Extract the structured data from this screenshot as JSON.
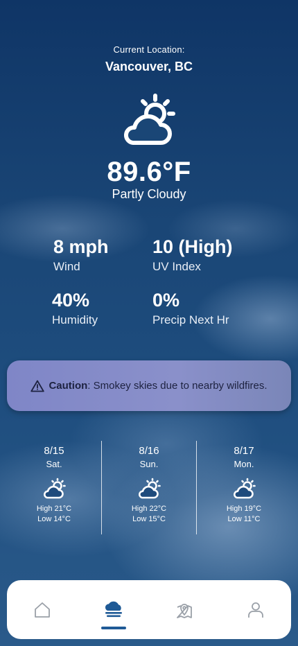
{
  "location": {
    "label": "Current Location:",
    "city": "Vancouver, BC"
  },
  "current": {
    "icon": "partly-cloudy-icon",
    "temperature": "89.6°F",
    "condition": "Partly Cloudy"
  },
  "stats": [
    {
      "value": "8 mph",
      "label": "Wind"
    },
    {
      "value": "10 (High)",
      "label": "UV Index"
    },
    {
      "value": "40%",
      "label": "Humidity"
    },
    {
      "value": "0%",
      "label": "Precip Next Hr"
    }
  ],
  "alert": {
    "icon": "warning-triangle-icon",
    "title": "Caution",
    "message": ": Smokey skies due to nearby wildfires."
  },
  "forecast": [
    {
      "date": "8/15",
      "weekday": "Sat.",
      "icon": "partly-cloudy-icon",
      "high": "High 21°C",
      "low": "Low 14°C"
    },
    {
      "date": "8/16",
      "weekday": "Sun.",
      "icon": "partly-cloudy-icon",
      "high": "High 22°C",
      "low": "Low 15°C"
    },
    {
      "date": "8/17",
      "weekday": "Mon.",
      "icon": "partly-cloudy-icon",
      "high": "High 19°C",
      "low": "Low 11°C"
    }
  ],
  "tabs": [
    {
      "name": "home",
      "icon": "home-icon",
      "active": false
    },
    {
      "name": "weather",
      "icon": "weather-icon",
      "active": true
    },
    {
      "name": "map",
      "icon": "map-pin-icon",
      "active": false
    },
    {
      "name": "profile",
      "icon": "person-icon",
      "active": false
    }
  ],
  "colors": {
    "accent": "#1f5a96",
    "alert_bg": "#8a90ca",
    "alert_text": "#1d2240",
    "tab_inactive": "#9aa0a8"
  }
}
